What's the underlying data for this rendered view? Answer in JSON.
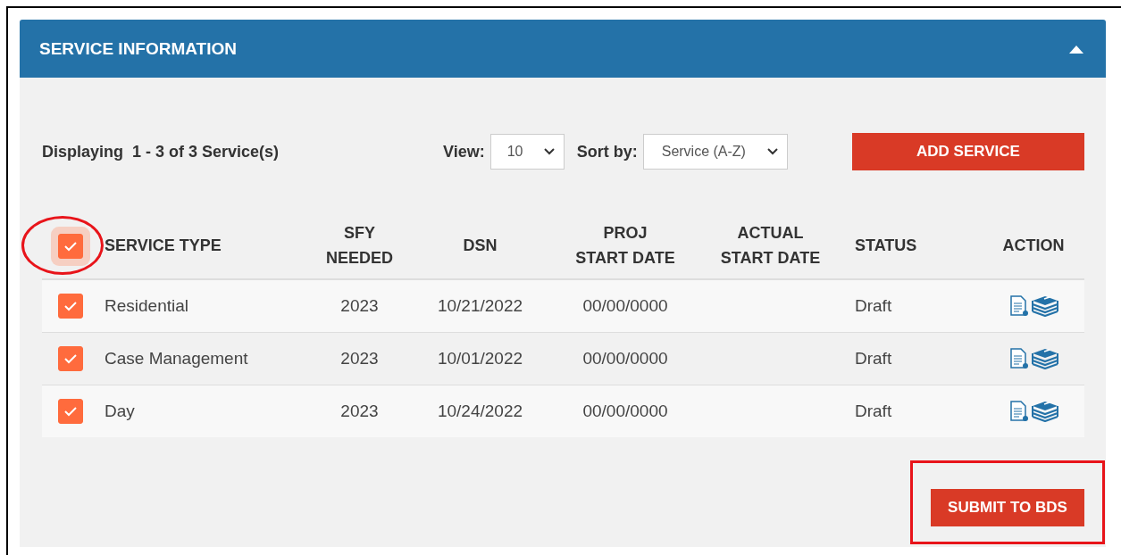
{
  "panel": {
    "title": "SERVICE INFORMATION",
    "expanded": true
  },
  "toolbar": {
    "summary": "Displaying  1 - 3 of 3 Service(s)",
    "view_label": "View:",
    "view_value": "10",
    "sort_label": "Sort by:",
    "sort_value": "Service (A-Z)",
    "add_button": "ADD SERVICE"
  },
  "table": {
    "select_all": {
      "checked": true,
      "focused": true,
      "circled": true
    },
    "columns": [
      "SERVICE TYPE",
      "SFY\nNEEDED",
      "DSN",
      "PROJ\nSTART DATE",
      "ACTUAL\nSTART DATE",
      "STATUS",
      "ACTION"
    ],
    "rows": [
      {
        "checked": true,
        "service_type": "Residential",
        "sfy_needed": "2023",
        "dsn": "10/21/2022",
        "proj_start_date": "00/00/0000",
        "status": "Draft"
      },
      {
        "checked": true,
        "service_type": "Case Management",
        "sfy_needed": "2023",
        "dsn": "10/01/2022",
        "proj_start_date": "00/00/0000",
        "status": "Draft"
      },
      {
        "checked": true,
        "service_type": "Day",
        "sfy_needed": "2023",
        "dsn": "10/24/2022",
        "proj_start_date": "00/00/0000",
        "status": "Draft"
      }
    ]
  },
  "submit_button": {
    "label": "SUBMIT TO BDS",
    "boxed": true
  }
}
